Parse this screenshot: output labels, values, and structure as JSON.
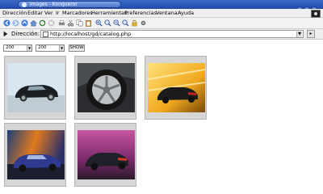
{
  "window": {
    "title": "images - Konqueror"
  },
  "menu": [
    {
      "label": "Dirección"
    },
    {
      "label": "Editar"
    },
    {
      "label": "Ver"
    },
    {
      "label": "Ir"
    },
    {
      "label": "Marcadores"
    },
    {
      "label": "Herramientas"
    },
    {
      "label": "Preferencias"
    },
    {
      "label": "Ventana"
    },
    {
      "label": "Ayuda"
    }
  ],
  "location": {
    "label": "Dirección:",
    "url": "http://localhost/gd/catalog.php"
  },
  "controls": {
    "width_value": "200",
    "height_value": "200",
    "show_label": "SHOW"
  },
  "colors": {
    "titlebar": "#2f5bbd",
    "thumb_frame": "#d6d6d6"
  }
}
